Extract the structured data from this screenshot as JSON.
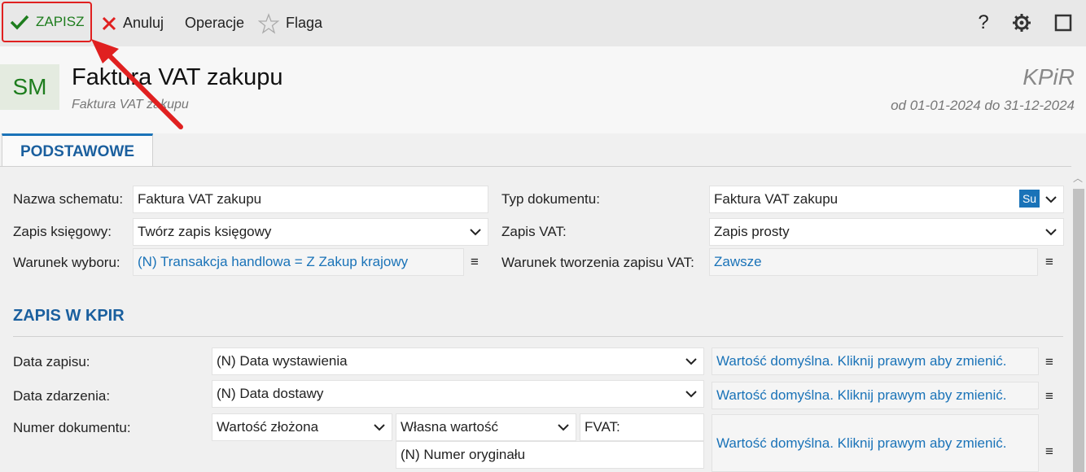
{
  "toolbar": {
    "save_label": "ZAPISZ",
    "cancel_label": "Anuluj",
    "operations_label": "Operacje",
    "flag_label": "Flaga",
    "help_label": "?"
  },
  "header": {
    "avatar": "SM",
    "title": "Faktura VAT zakupu",
    "subtitle": "Faktura VAT zakupu",
    "kpir": "KPiR",
    "range": "od 01-01-2024 do 31-12-2024"
  },
  "tabs": [
    {
      "label": "PODSTAWOWE"
    }
  ],
  "form": {
    "nazwa_schematu": {
      "label": "Nazwa schematu:",
      "value": "Faktura VAT zakupu"
    },
    "zapis_ksiegowy": {
      "label": "Zapis księgowy:",
      "value": "Twórz zapis księgowy"
    },
    "warunek_wyboru": {
      "label": "Warunek wyboru:",
      "value": "(N) Transakcja handlowa = Z Zakup krajowy"
    },
    "typ_dokumentu": {
      "label": "Typ dokumentu:",
      "value": "Faktura VAT zakupu",
      "badge": "Su"
    },
    "zapis_vat": {
      "label": "Zapis VAT:",
      "value": "Zapis prosty"
    },
    "warunek_vat": {
      "label": "Warunek tworzenia zapisu VAT:",
      "value": "Zawsze"
    }
  },
  "section_kpir": {
    "title": "ZAPIS W KPIR",
    "data_zapisu": {
      "label": "Data zapisu:",
      "value": "(N) Data wystawienia",
      "default": "Wartość domyślna. Kliknij prawym aby zmienić."
    },
    "data_zdarzenia": {
      "label": "Data zdarzenia:",
      "value": "(N) Data dostawy",
      "default": "Wartość domyślna. Kliknij prawym aby zmienić."
    },
    "numer_dokumentu": {
      "label": "Numer dokumentu:",
      "type": "Wartość złożona",
      "sub_type": "Własna wartość",
      "prefix": "FVAT:",
      "second": "(N) Numer oryginału",
      "default": "Wartość domyślna. Kliknij prawym aby zmienić."
    }
  },
  "menu_glyph": "≡",
  "colors": {
    "accent": "#1a73b8",
    "save_green": "#1e7d1e",
    "highlight_red": "#e02020"
  }
}
